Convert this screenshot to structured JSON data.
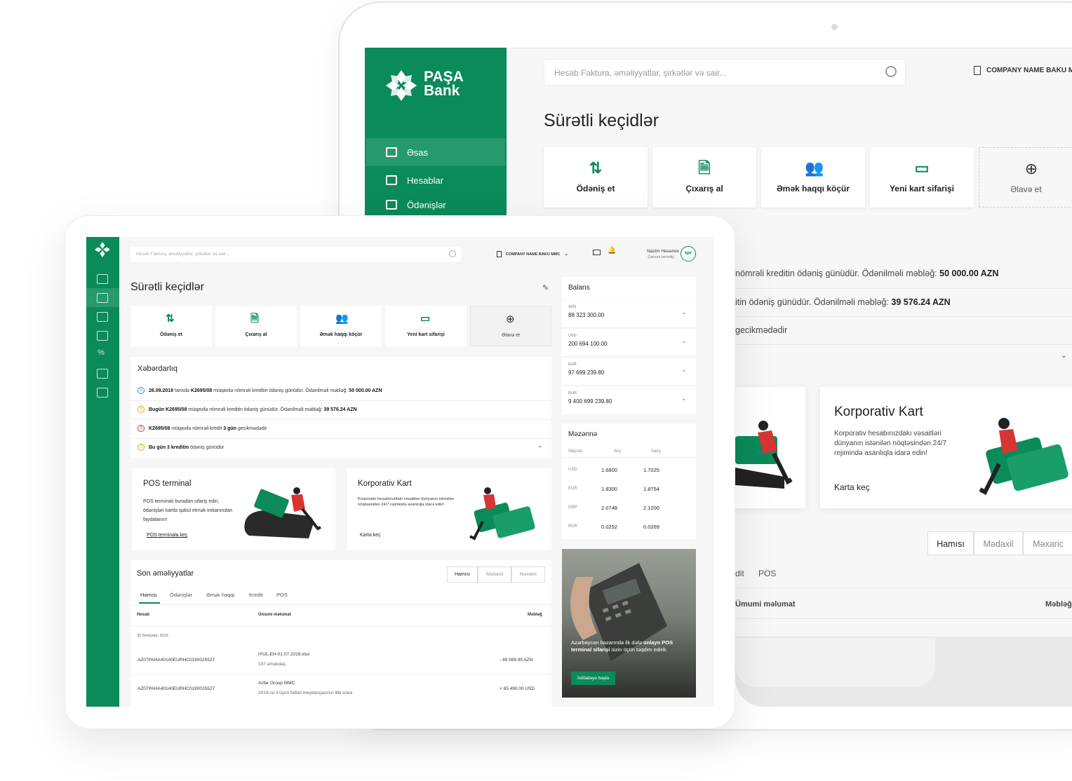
{
  "back": {
    "brand": {
      "line1": "PAŞA",
      "line2": "Bank"
    },
    "nav": [
      {
        "label": "Əsas",
        "icon": "dashboard-icon"
      },
      {
        "label": "Hesablar",
        "icon": "list-icon"
      },
      {
        "label": "Ödənişlər",
        "icon": "edit-icon"
      }
    ],
    "search_placeholder": "Hesab Faktura, əməliyyatlar, şirkətlər və sair...",
    "company": "COMPANY NAME BAKU M",
    "title": "Sürətli keçidlər",
    "quick": [
      {
        "label": "Ödəniş et",
        "icon": "transfer-arrows-icon"
      },
      {
        "label": "Çıxarış al",
        "icon": "document-icon"
      },
      {
        "label": "Əmək haqqı köçür",
        "icon": "users-icon"
      },
      {
        "label": "Yeni kart sifarişi",
        "icon": "card-icon"
      },
      {
        "label": "Əlavə et",
        "icon": "add-circle-icon"
      }
    ],
    "alert1_text": "nömrəli kreditin ödəniş günüdür. Ödənilməli məbləğ:",
    "alert1_amount": "50 000.00 AZN",
    "alert2_text": "itin ödəniş günüdür. Ödənilməli məbləğ:",
    "alert2_amount": "39 576.24 AZN",
    "alert3_text": "gecikmədədir",
    "korp_title": "Korporativ Kart",
    "korp_desc": "Korporativ hesabınızdakı vəsaitləri dünyanın istənilən nöqtəsindən 24/7 rejimində asanlıqla idarə edin!",
    "korp_link": "Karta keç",
    "seg": [
      "Hamısı",
      "Mədaxil",
      "Məxaric"
    ],
    "tab_partial": "dit",
    "tab_pos": "POS",
    "col_info": "Ümumi məlumat",
    "col_amount": "Məbləğ"
  },
  "front": {
    "search_placeholder": "Hesab Faktura, əməliyyatlar, şirkətlər və sair...",
    "company": "COMPANY NAME BAKU MMC",
    "user_name": "Nazim Həsənov",
    "user_role": "Qanuni təmsilçi",
    "user_initials": "NH",
    "title": "Sürətli keçidlər",
    "quick": [
      {
        "label": "Ödəniş et"
      },
      {
        "label": "Çıxarış al"
      },
      {
        "label": "Əmək haqqı köçür"
      },
      {
        "label": "Yeni kart sifarişi"
      },
      {
        "label": "Əlavə et"
      }
    ],
    "alerts_title": "Xəbərdarlıq",
    "alerts": [
      {
        "pre": "26.09.2019",
        "t1": "tarixdə",
        "b1": "K2695/08",
        "t2": "müqavilə nömrəli kreditin ödəniş günüdür. Ödənilməli məbləğ:",
        "b2": "50 000.00 AZN"
      },
      {
        "pre": "Bugün K2695/08",
        "t1": "müqavilə nömrəli kreditin ödəniş günüdür. Ödənilməli məbləğ:",
        "b1": "39 576.24 AZN",
        "t2": "",
        "b2": ""
      },
      {
        "pre": "K2695/08",
        "t1": "müqavilə nömrəli kredit",
        "b1": "3 gün",
        "t2": "gecikmədədir",
        "b2": ""
      },
      {
        "pre": "Bu gün 3 kreditin",
        "t1": "ödəniş günüdür",
        "b1": "",
        "t2": "",
        "b2": ""
      }
    ],
    "pos_title": "POS terminal",
    "pos_desc": "POS terminalı buradan sifariş edin, ödənişləri kartla qəbul etmək imkanından faydalanın!",
    "pos_link": "POS terminala keç",
    "korp_title": "Korporativ Kart",
    "korp_desc": "Korporativ hesabınızdakı vəsaitləri dünyanın istənilən nöqtəsindən 24/7 rejimində asanlıqla idarə edin!",
    "korp_link": "Karta keç",
    "ops_title": "Son əməliyyatlar",
    "seg": [
      "Hamısı",
      "Mədaxil",
      "Məxaric"
    ],
    "tabs": [
      "Hamısı",
      "Ödənişlər",
      "Əmək haqqı",
      "Kredit",
      "POS"
    ],
    "col_account": "Hesab",
    "col_info": "Ümumi məlumat",
    "col_amount": "Məbləğ",
    "date": "30 Sentyabr, 2019",
    "rows": [
      {
        "account": "AZ07PAHA40140EURHC0190025527",
        "info1": "IYUL-EH-01.07.2019.xlsx",
        "info2": "107 əməkdaş",
        "amount": "- 49 089.99 AZN"
      },
      {
        "account": "AZ07PAHA40140EURHC0190025527",
        "info1": "Azfar Group MMC",
        "info2": "2019-cu il üçün futbol meydançasının illik icarə",
        "amount": "+ 65 490.00 USD"
      }
    ],
    "balance_title": "Balans",
    "balances": [
      {
        "cur": "AZN",
        "val": "88 323 300.00"
      },
      {
        "cur": "USD",
        "val": "200 694 100.00"
      },
      {
        "cur": "EUR",
        "val": "97 699 239.80"
      },
      {
        "cur": "RUR",
        "val": "9 400 699 239.80"
      }
    ],
    "rates_title": "Məzənnə",
    "rates_head": [
      "Valyuta",
      "Alış",
      "Satış"
    ],
    "rates": [
      {
        "cur": "USD",
        "buy": "1.6800",
        "sell": "1.7025"
      },
      {
        "cur": "EUR",
        "buy": "1.8300",
        "sell": "1.8754"
      },
      {
        "cur": "GBP",
        "buy": "2.0748",
        "sell": "2.1200"
      },
      {
        "cur": "RUR",
        "buy": "0.0252",
        "sell": "0.0269"
      }
    ],
    "promo_pre": "Azərbaycan bazarında ilk dəfə",
    "promo_b1": "onlayn POS terminal sifarişi",
    "promo_post": "sizin üçün təqdim edirik.",
    "promo_btn": "İstifadəyə başla"
  },
  "colors": {
    "brand": "#0b8a5a",
    "accent_green": "#26996d",
    "warning": "#f0a500",
    "danger": "#d93434",
    "info": "#2d8fd8"
  }
}
